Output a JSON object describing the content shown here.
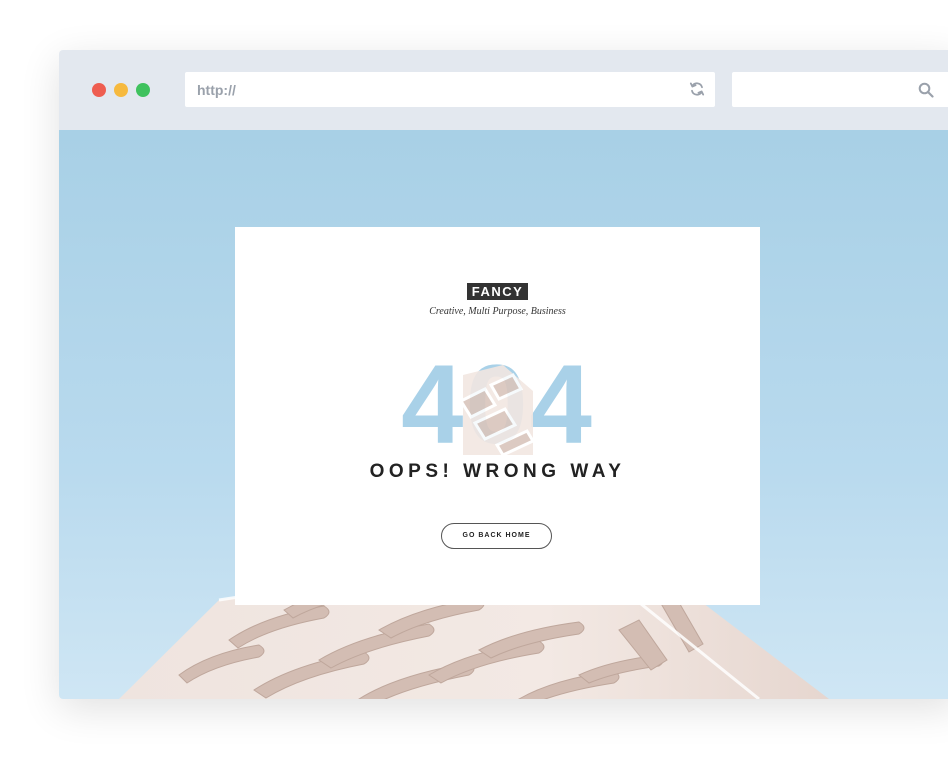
{
  "browser": {
    "url_text": "http://",
    "search_value": "",
    "icons": {
      "reload": "reload-icon",
      "search": "search-icon"
    },
    "controls": [
      "close",
      "minimize",
      "maximize"
    ]
  },
  "page": {
    "brand": "FANCY",
    "tagline": "Creative, Multi Purpose, Business",
    "error_code": "404",
    "message": "OOPS! WRONG WAY",
    "button_label": "GO BACK HOME"
  },
  "colors": {
    "sky": "#a8d0e6",
    "digits": "#a9d1e8",
    "building": "#efe3dd",
    "brand_bg": "#333333"
  }
}
